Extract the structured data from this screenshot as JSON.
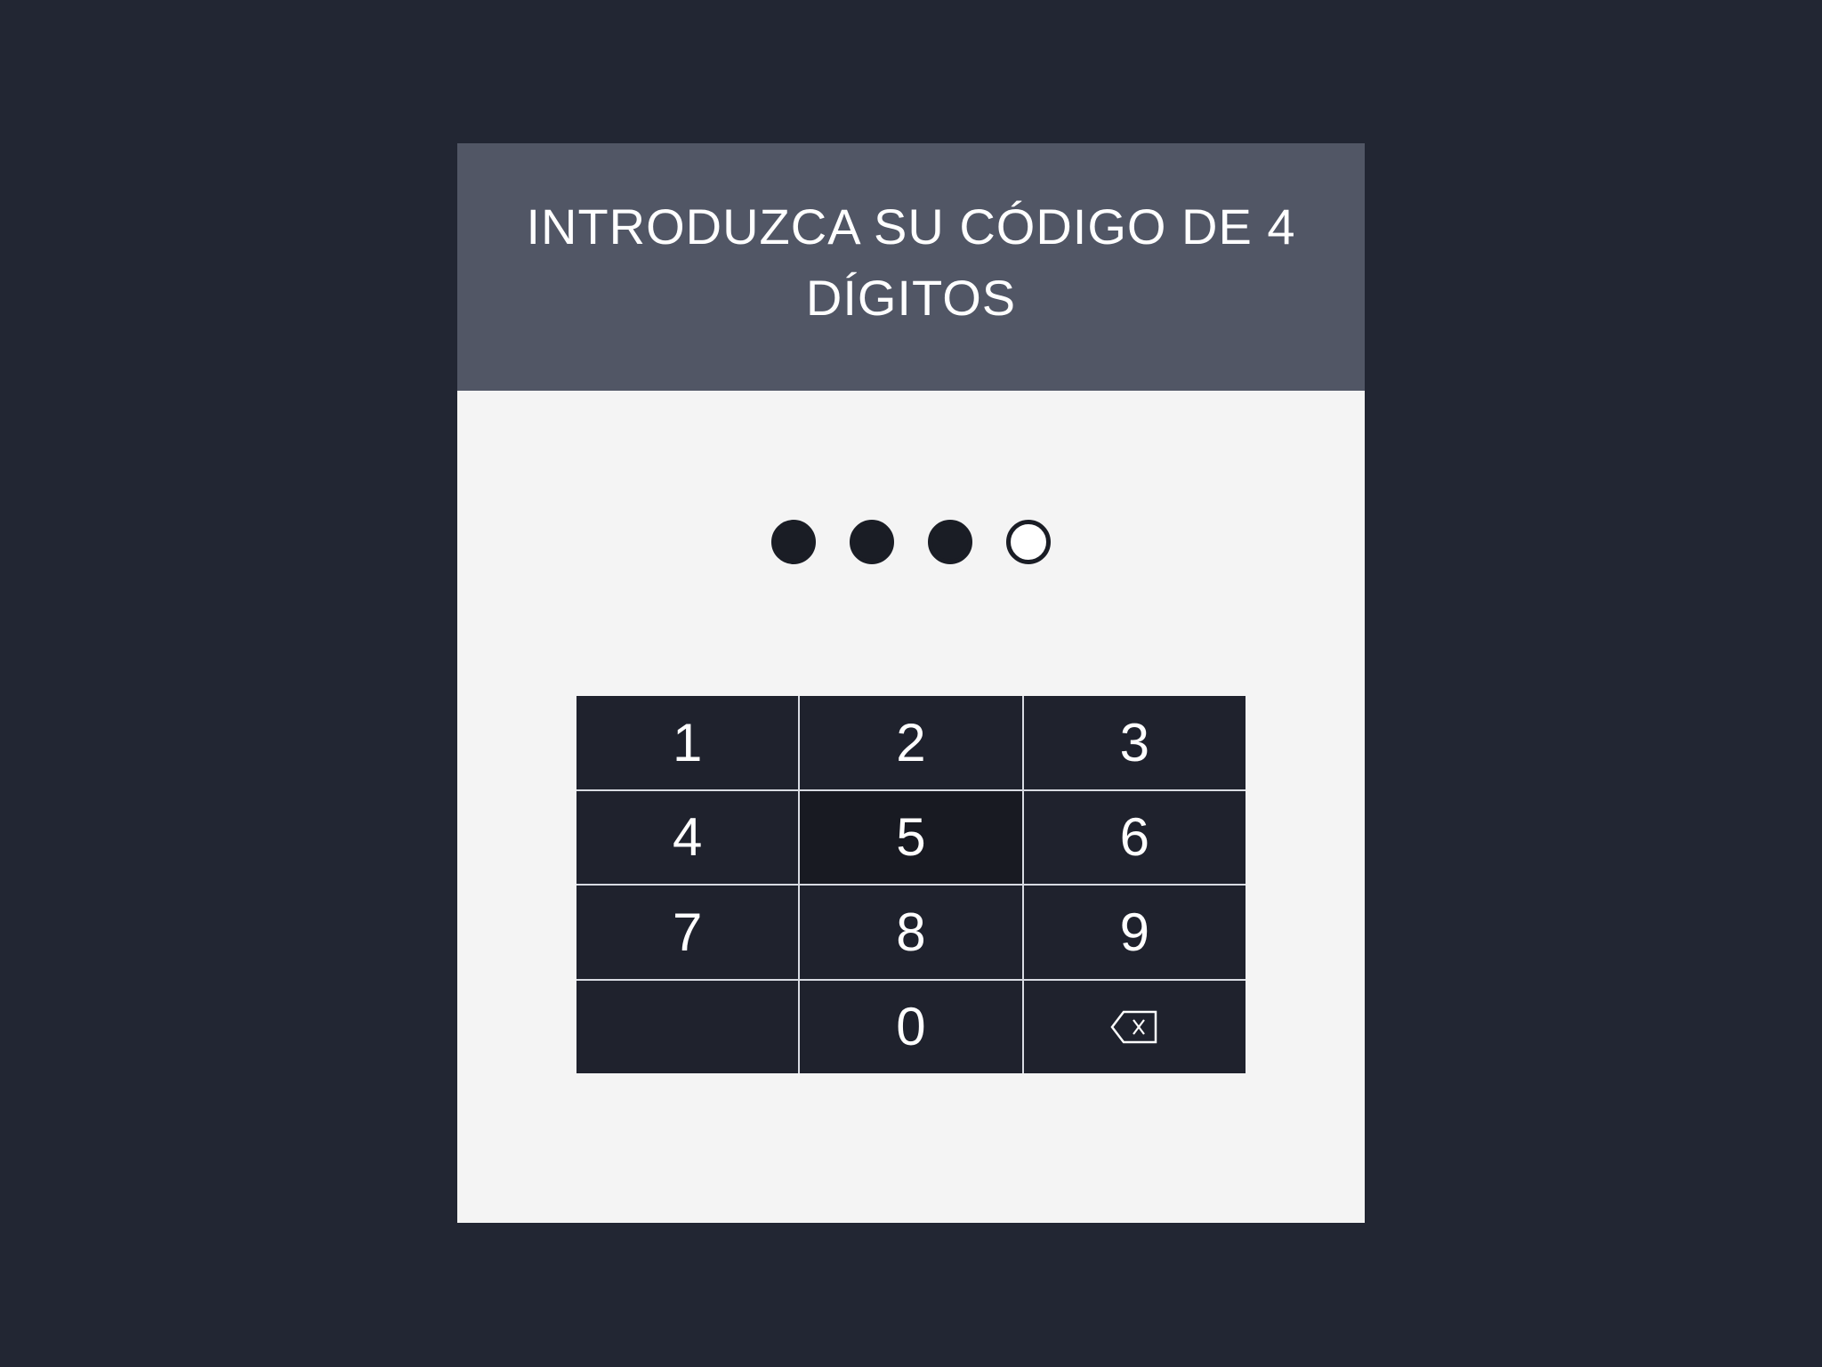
{
  "colors": {
    "background": "#222633",
    "header": "#515665",
    "panel": "#f4f4f4",
    "key": "#1f222d",
    "key_pressed": "#181a22",
    "dot_filled": "#1a1d25"
  },
  "dialog": {
    "title": "INTRODUZCA SU CÓDIGO DE 4 DÍGITOS"
  },
  "pin": {
    "length": 4,
    "entered_count": 3
  },
  "keypad": {
    "keys": [
      "1",
      "2",
      "3",
      "4",
      "5",
      "6",
      "7",
      "8",
      "9",
      "",
      "0",
      "backspace-icon"
    ],
    "pressed_key": "5"
  }
}
